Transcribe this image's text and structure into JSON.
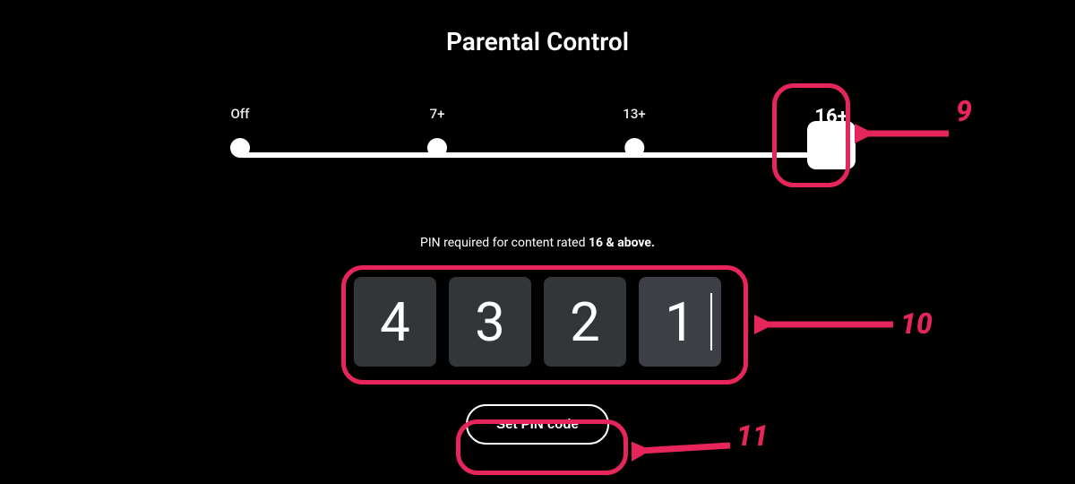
{
  "title": "Parental Control",
  "slider": {
    "stops": [
      "Off",
      "7+",
      "13+",
      "16+"
    ],
    "selected_index": 3
  },
  "hint_prefix": "PIN required for content rated ",
  "hint_bold": "16 & above.",
  "pin": {
    "digits": [
      "4",
      "3",
      "2",
      "1"
    ],
    "active_index": 3
  },
  "button_label": "Set PIN code",
  "annotations": {
    "a9": "9",
    "a10": "10",
    "a11": "11"
  },
  "colors": {
    "accent": "#e6265a",
    "bg": "#000000"
  }
}
